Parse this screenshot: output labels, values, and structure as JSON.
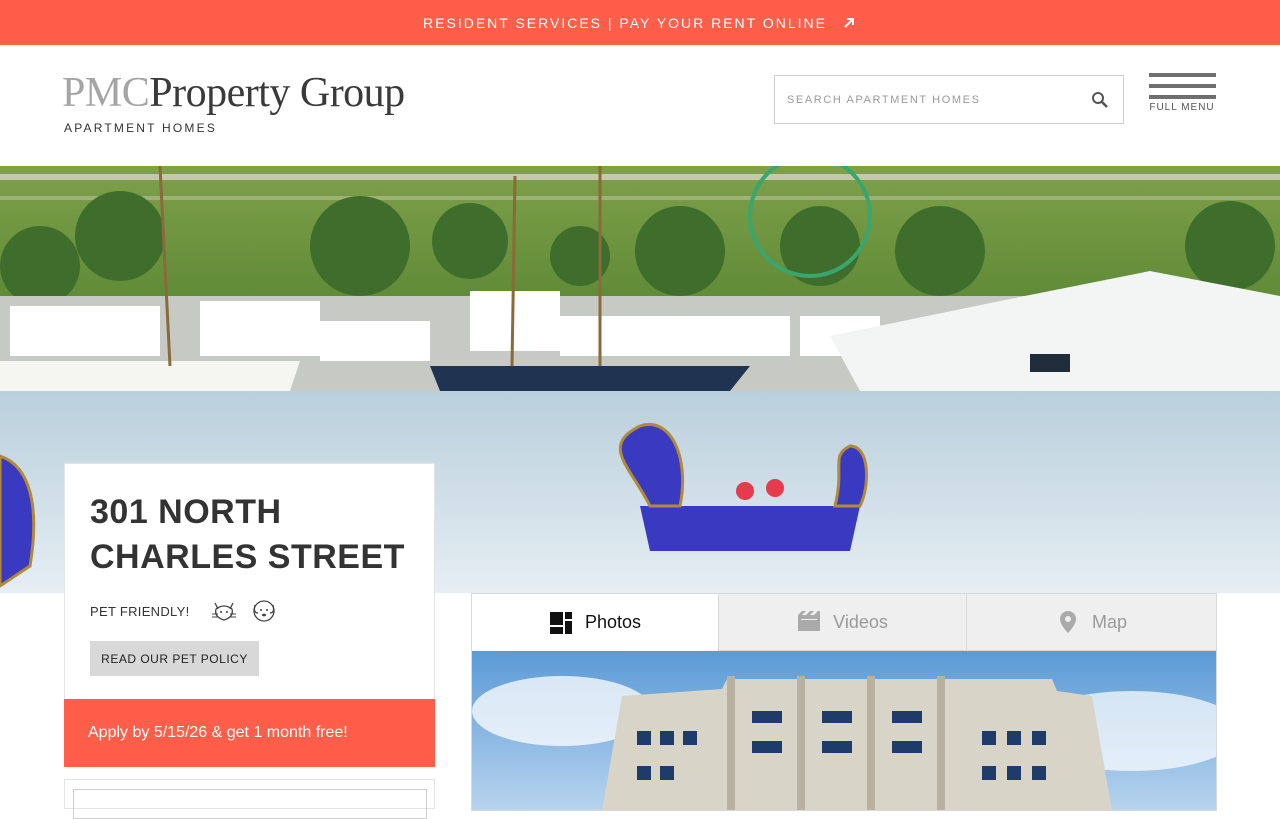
{
  "banner": {
    "text": "RESIDENT SERVICES | PAY YOUR RENT ONLINE",
    "icon": "external-arrow-icon"
  },
  "header": {
    "logo_pmc": "PMC",
    "logo_rest": "Property Group",
    "logo_sub": "APARTMENT HOMES",
    "search_placeholder": "SEARCH APARTMENT HOMES",
    "menu_label": "FULL MENU"
  },
  "property": {
    "title": "301 NORTH CHARLES STREET",
    "pet_label": "PET FRIENDLY!",
    "pet_policy_button": "READ OUR PET POLICY",
    "promo": "Apply by 5/15/26 & get 1 month free!"
  },
  "media": {
    "tabs": [
      {
        "label": "Photos",
        "icon": "photos-grid-icon",
        "active": true
      },
      {
        "label": "Videos",
        "icon": "video-icon",
        "active": false
      },
      {
        "label": "Map",
        "icon": "map-pin-icon",
        "active": false
      }
    ]
  },
  "colors": {
    "accent": "#ff5f4a",
    "tab_inactive_bg": "#efefef",
    "button_gray": "#d8d8d8"
  }
}
